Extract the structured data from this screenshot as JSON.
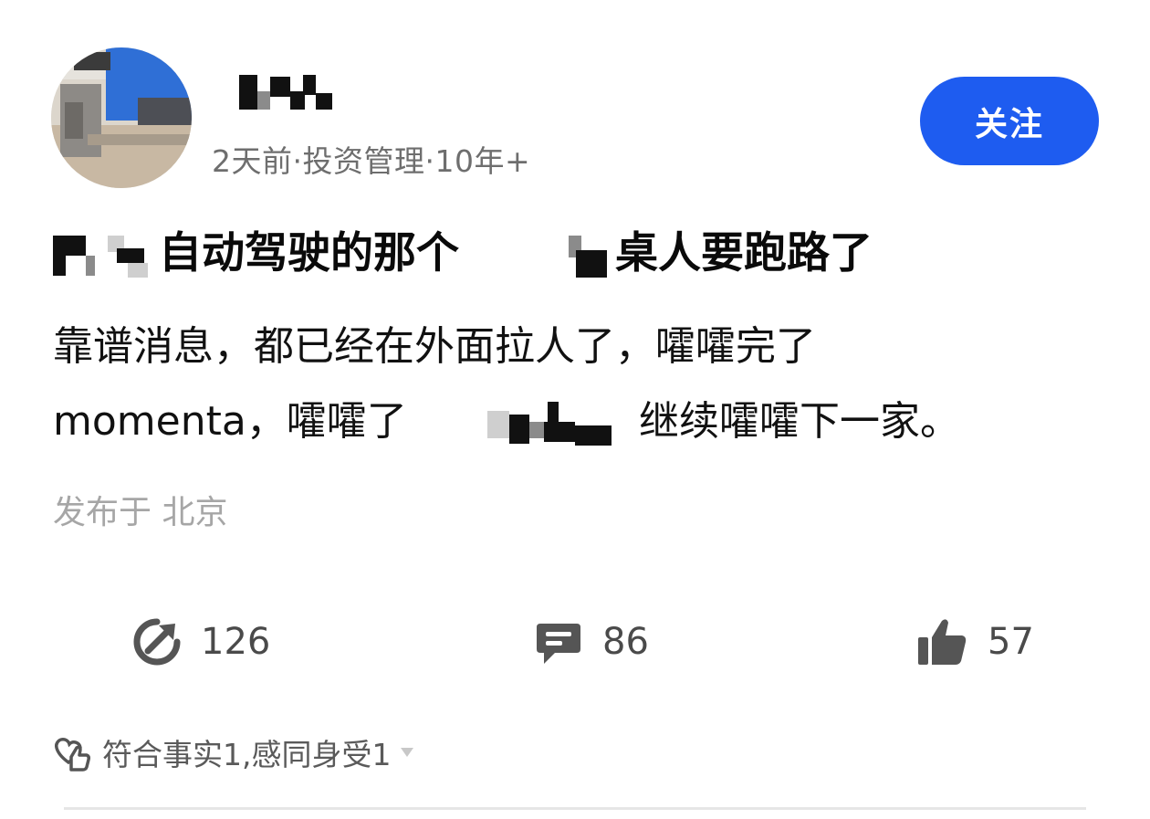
{
  "header": {
    "meta_text": "2天前·投资管理·10年+",
    "follow_label": "关注"
  },
  "post": {
    "title_part_1": "自动驾驶的那个",
    "title_part_2": "桌人要跑路了",
    "body_line_1": "靠谱消息，都已经在外面拉人了，嚯嚯完了",
    "body_line_2a": "momenta，嚯嚯了",
    "body_line_2b": "继续嚯嚯下一家。",
    "location": "发布于 北京"
  },
  "stats": {
    "shares": "126",
    "comments": "86",
    "likes": "57"
  },
  "reactions": {
    "text": "符合事实1,感同身受1"
  },
  "colors": {
    "accent": "#1e5cf0",
    "meta_gray": "#6e6e6e",
    "location_gray": "#a6a6a6"
  },
  "icons": {
    "share": "share-icon",
    "comment": "comment-icon",
    "like": "thumbs-up-icon",
    "reaction": "reaction-icon",
    "dropdown": "chevron-down-icon"
  }
}
